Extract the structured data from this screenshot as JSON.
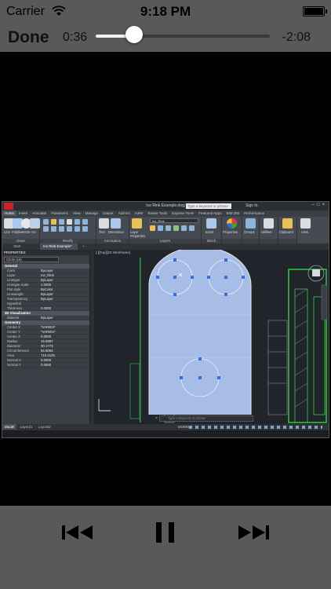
{
  "status_bar": {
    "carrier": "Carrier",
    "time": "9:18 PM"
  },
  "player": {
    "done_label": "Done",
    "elapsed": "0:36",
    "remaining": "-2:08",
    "progress_fraction": 0.22
  },
  "autocad": {
    "window_title": "Ice Rink Example.dwg",
    "search_placeholder": "Type a keyword or phrase",
    "sign_in": "Sign In",
    "ribbon_tabs": [
      "Home",
      "Insert",
      "Annotate",
      "Parametric",
      "View",
      "Manage",
      "Output",
      "Add-ins",
      "A360",
      "Raster Tools",
      "Express Tools",
      "Featured Apps",
      "BIM 360",
      "Performance"
    ],
    "active_ribbon_tab": "Home",
    "ribbon_groups": [
      "Draw",
      "Modify",
      "Annotation",
      "Layers",
      "Block",
      "",
      "",
      "",
      ""
    ],
    "ribbon_labels": {
      "line": "Line",
      "polyline": "Polyline",
      "circle": "Circle",
      "arc": "Arc",
      "text": "Text",
      "dimension": "Dimension",
      "layer_properties": "Layer Properties",
      "layer_name": "Ice_Rink",
      "insert": "Insert",
      "properties": "Properties",
      "groups": "Groups",
      "utilities": "Utilities",
      "clipboard": "Clipboard",
      "view": "View"
    },
    "doc_tabs": [
      "Start",
      "Ice Rink Example*"
    ],
    "active_doc_tab": "Ice Rink Example*",
    "properties": {
      "header": "PROPERTIES",
      "selection": "Circle (15)",
      "sections": [
        {
          "title": "General",
          "rows": [
            {
              "k": "Color",
              "v": "ByLayer"
            },
            {
              "k": "Layer",
              "v": "Ice_Rink"
            },
            {
              "k": "Linetype",
              "v": "ByLayer"
            },
            {
              "k": "Linetype scale",
              "v": "1.0000"
            },
            {
              "k": "Plot style",
              "v": "ByColor"
            },
            {
              "k": "Lineweight",
              "v": "ByLayer"
            },
            {
              "k": "Transparency",
              "v": "ByLayer"
            },
            {
              "k": "Hyperlink",
              "v": ""
            },
            {
              "k": "Thickness",
              "v": "0.0000"
            }
          ]
        },
        {
          "title": "3D Visualization",
          "rows": [
            {
              "k": "Material",
              "v": "ByLayer"
            }
          ]
        },
        {
          "title": "Geometry",
          "rows": [
            {
              "k": "Center X",
              "v": "*VARIES*"
            },
            {
              "k": "Center Y",
              "v": "*VARIES*"
            },
            {
              "k": "Center Z",
              "v": "0.0000"
            },
            {
              "k": "Radius",
              "v": "15.0887"
            },
            {
              "k": "Diameter",
              "v": "30.1773"
            },
            {
              "k": "Circumference",
              "v": "94.8063"
            },
            {
              "k": "Area",
              "v": "715.2125"
            },
            {
              "k": "Normal X",
              "v": "0.0000"
            },
            {
              "k": "Normal Y",
              "v": "0.0000"
            }
          ]
        }
      ]
    },
    "view_label": "[-][Top][2D Wireframe]",
    "layout_tabs": [
      "Model",
      "Layout1",
      "Layout2"
    ],
    "active_layout_tab": "Model",
    "model_label": "MODEL"
  }
}
